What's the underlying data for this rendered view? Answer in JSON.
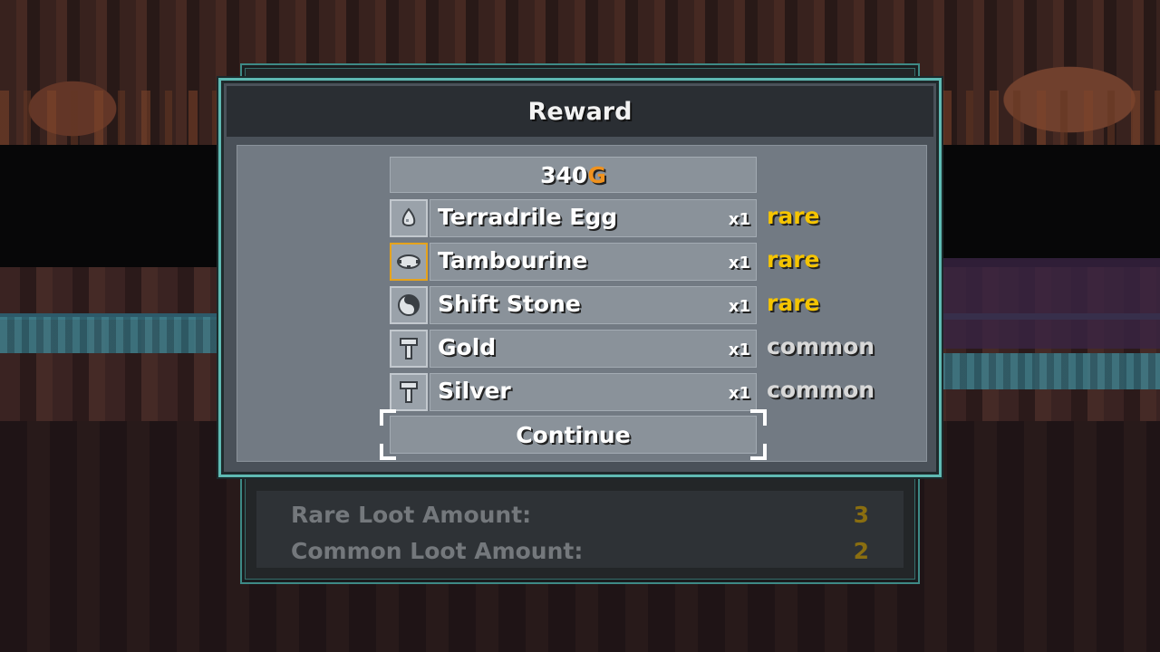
{
  "dialog": {
    "title": "Reward",
    "gold_amount": "340",
    "gold_symbol": "G",
    "continue_label": "Continue"
  },
  "items": [
    {
      "name": "Terradrile Egg",
      "qty": "x1",
      "rarity": "rare",
      "icon": "egg-icon"
    },
    {
      "name": "Tambourine",
      "qty": "x1",
      "rarity": "rare",
      "icon": "tambourine-icon"
    },
    {
      "name": "Shift Stone",
      "qty": "x1",
      "rarity": "rare",
      "icon": "shift-stone-icon"
    },
    {
      "name": "Gold",
      "qty": "x1",
      "rarity": "common",
      "icon": "ingot-icon"
    },
    {
      "name": "Silver",
      "qty": "x1",
      "rarity": "common",
      "icon": "ingot-icon"
    }
  ],
  "summary": {
    "rare_label": "Rare Loot Amount:",
    "rare_value": "3",
    "common_label": "Common Loot Amount:",
    "common_value": "2"
  },
  "colors": {
    "rare": "#f5c400",
    "common": "#d8d8d8",
    "gold_symbol": "#f0921e",
    "selected_border": "#e6a31c",
    "dialog_border": "#5fbab3"
  }
}
